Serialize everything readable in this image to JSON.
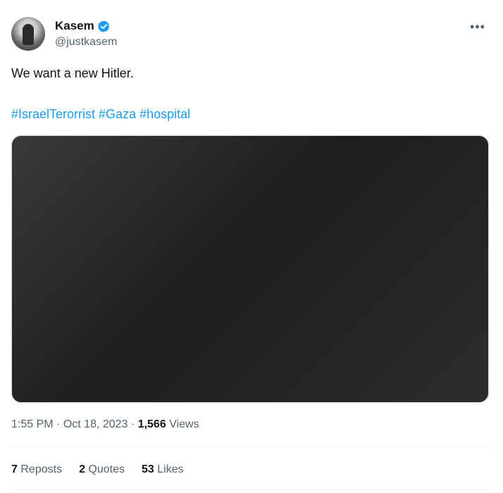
{
  "author": {
    "display_name": "Kasem",
    "handle": "@justkasem",
    "verified": true
  },
  "tweet": {
    "text": "We want a new Hitler.",
    "hashtags": [
      "#IsraelTerorrist",
      "#Gaza",
      "#hospital"
    ]
  },
  "media": {
    "placeholder_label": ""
  },
  "meta": {
    "time": "1:55 PM",
    "date": "Oct 18, 2023",
    "sep": "·",
    "views_count": "1,566",
    "views_label": "Views"
  },
  "stats": {
    "reposts_count": "7",
    "reposts_label": "Reposts",
    "quotes_count": "2",
    "quotes_label": "Quotes",
    "likes_count": "53",
    "likes_label": "Likes"
  },
  "colors": {
    "link": "#1d9bf0",
    "secondary": "#536471",
    "verified": "#1d9bf0"
  }
}
